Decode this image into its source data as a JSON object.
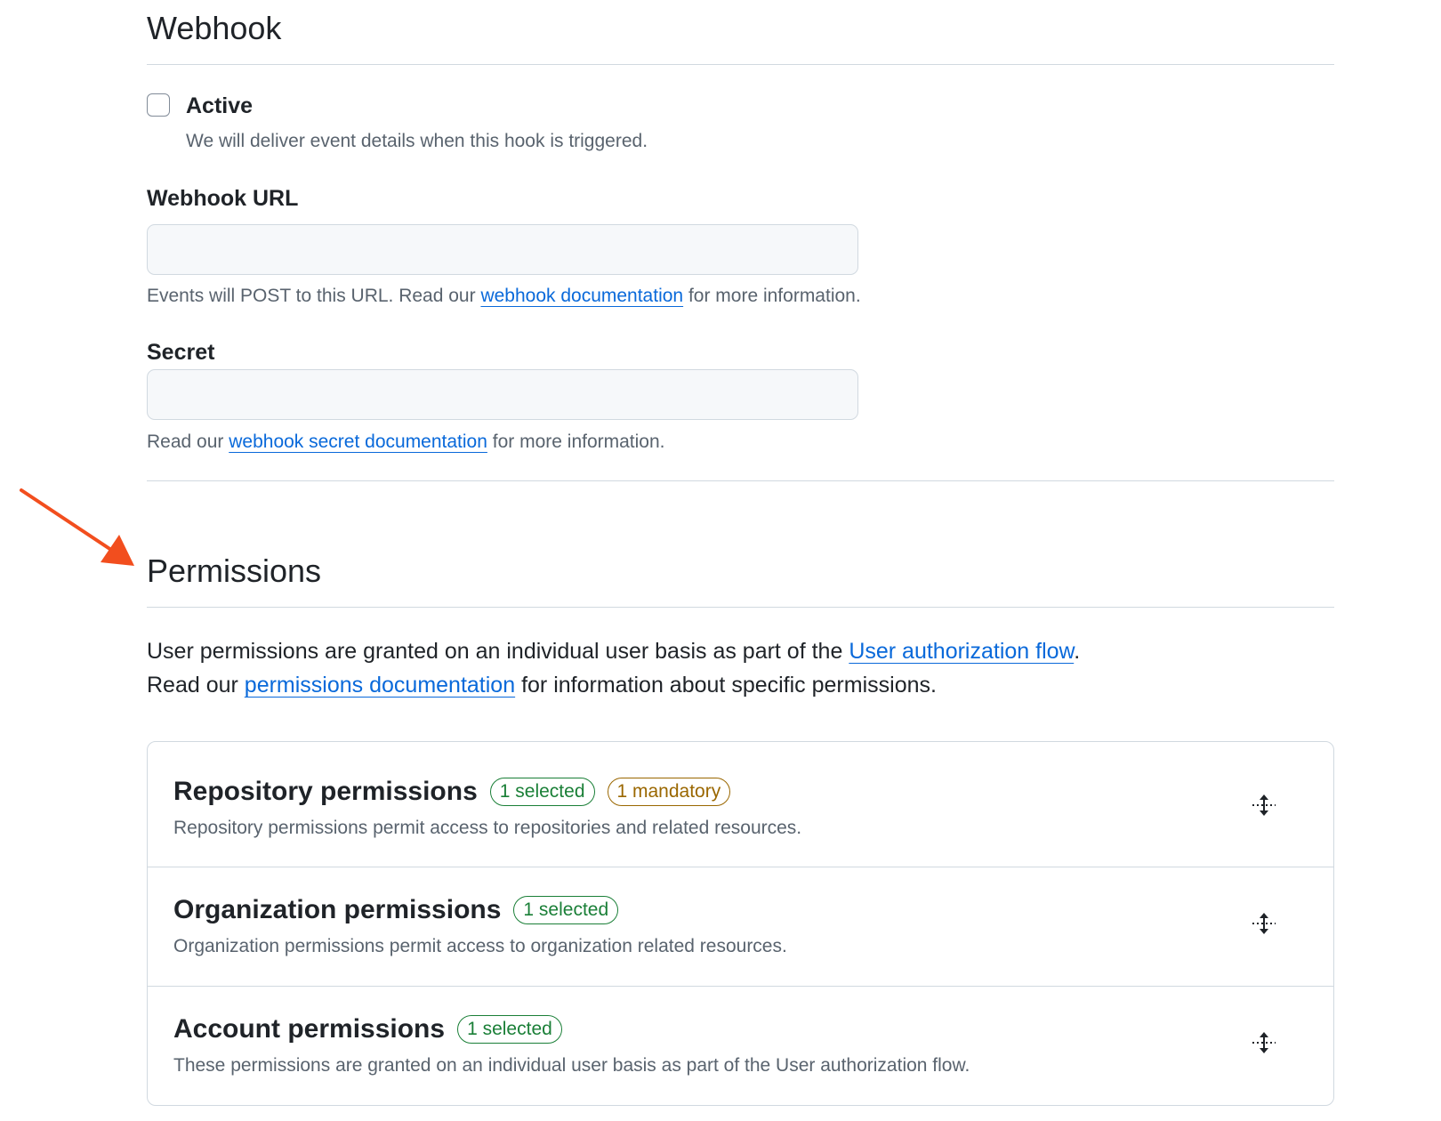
{
  "webhook": {
    "title": "Webhook",
    "active_label": "Active",
    "active_checked": false,
    "active_help": "We will deliver event details when this hook is triggered.",
    "url_label": "Webhook URL",
    "url_value": "",
    "url_help_before": "Events will POST to this URL. Read our ",
    "url_help_link": "webhook documentation",
    "url_help_after": " for more information.",
    "secret_label": "Secret",
    "secret_value": "",
    "secret_help_before": "Read our ",
    "secret_help_link": "webhook secret documentation",
    "secret_help_after": " for more information."
  },
  "permissions": {
    "title": "Permissions",
    "intro_line1_before": "User permissions are granted on an individual user basis as part of the ",
    "intro_line1_link": "User authorization flow",
    "intro_line1_after": ".",
    "intro_line2_before": "Read our ",
    "intro_line2_link": "permissions documentation",
    "intro_line2_after": " for information about specific permissions.",
    "groups": [
      {
        "title": "Repository permissions",
        "badge_selected": "1 selected",
        "badge_mandatory": "1 mandatory",
        "description": "Repository permissions permit access to repositories and related resources."
      },
      {
        "title": "Organization permissions",
        "badge_selected": "1 selected",
        "description": "Organization permissions permit access to organization related resources."
      },
      {
        "title": "Account permissions",
        "badge_selected": "1 selected",
        "description": "These permissions are granted on an individual user basis as part of the User authorization flow."
      }
    ]
  },
  "colors": {
    "link": "#0969da",
    "badge_green": "#1a7f37",
    "badge_amber": "#9a6700",
    "annotation_arrow": "#f24e1e"
  },
  "icons": {
    "expand": "unfold-icon",
    "annotation": "annotation-arrow-icon"
  }
}
